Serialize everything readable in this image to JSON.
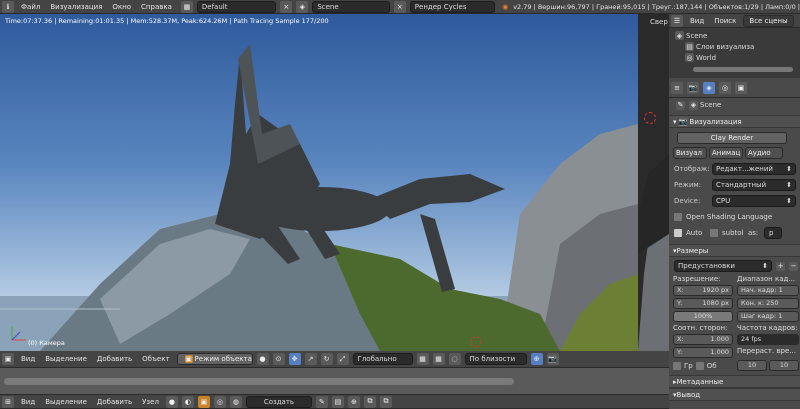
{
  "colors": {
    "accent": "#5680c2",
    "header": "#444444",
    "panel": "#4a4a4a"
  },
  "topbar": {
    "menu": [
      "Файл",
      "Визуализация",
      "Окно",
      "Справка"
    ],
    "layout": "Default",
    "scene": "Scene",
    "engine": "Рендер Cycles",
    "stats": "v2.79 | Вершин:96,797 | Граней:95,015 | Треуг.:187,144 | Объектов:1/29 | Ламп:0/0 |"
  },
  "viewport": {
    "render_info": "Time:07:37.36 | Remaining:01:01.35 | Mem:528.37M, Peak:624.26M | Path Tracing Sample 177/200",
    "camera_label": "(0) Камера"
  },
  "strip": {
    "label": "Свер"
  },
  "outliner": {
    "menu": [
      "Вид",
      "Поиск"
    ],
    "filter": "Все сцены",
    "items": [
      "Scene",
      "Слои визуализа",
      "World"
    ]
  },
  "properties": {
    "context": "Scene",
    "render_panel": {
      "title": "Визуализация",
      "render_btn": "Clay Render",
      "tabs": [
        "Визуал",
        "Анимац",
        "Аудио"
      ],
      "rows": [
        {
          "label": "Отображ:",
          "value": "Редакт...жений"
        },
        {
          "label": "Режим:",
          "value": "Стандартный"
        },
        {
          "label": "Device:",
          "value": "CPU"
        }
      ],
      "osl": "Open Shading Language",
      "auto": "Auto",
      "subtol": "subtol",
      "as_label": "as:",
      "as_value": "p"
    },
    "dims": {
      "title": "Размеры",
      "preset": "Предустановки визуал...",
      "res_label": "Разрешение:",
      "res_x": "X:",
      "res_x_val": "1920 px",
      "res_y": "Y:",
      "res_y_val": "1080 px",
      "res_pct": "100%",
      "range_label": "Диапазон кад...",
      "start": "Нач. кадр: 1",
      "end": "Кон. к: 250",
      "step": "Шаг кадр: 1",
      "aspect_label": "Соотн. сторон:",
      "ax": "X:",
      "ax_val": "1.000",
      "ay": "Y:",
      "ay_val": "1.000",
      "fps_label": "Частота кадров:",
      "fps": "24 fps",
      "remap_label": "Перераст. вре...",
      "remap_a": "10",
      "remap_b": "10",
      "border": "Гр",
      "crop": "Об"
    },
    "meta": "Метаданные",
    "output": "Вывод"
  },
  "view_header": {
    "menu": [
      "Вид",
      "Выделение",
      "Добавить",
      "Объект"
    ],
    "mode": "Режим объекта",
    "orientation": "Глобально",
    "pivot": "По близости"
  },
  "bottom_header": {
    "menu": [
      "Вид",
      "Выделение",
      "Добавить",
      "Узел"
    ],
    "create": "Создать"
  }
}
